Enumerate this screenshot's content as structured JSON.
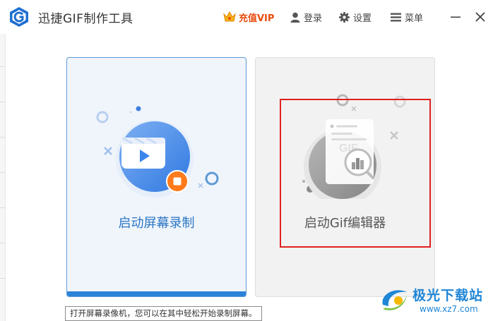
{
  "app": {
    "title": "迅捷GIF制作工具"
  },
  "titlebar": {
    "vip_label": "充值VIP",
    "login_label": "登录",
    "settings_label": "设置",
    "menu_label": "菜单"
  },
  "cards": [
    {
      "label": "启动屏幕录制",
      "icon": "screen-record-icon"
    },
    {
      "label": "启动Gif编辑器",
      "icon": "gif-editor-icon"
    }
  ],
  "tooltip": {
    "text": "打开屏幕录像机，您可以在其中轻松开始录制屏幕。"
  },
  "watermark": {
    "brand": "极光下载站",
    "url": "www.xz7.com"
  },
  "colors": {
    "accent": "#2b82d9",
    "vip": "#e84c0e",
    "highlight": "#e02020"
  }
}
